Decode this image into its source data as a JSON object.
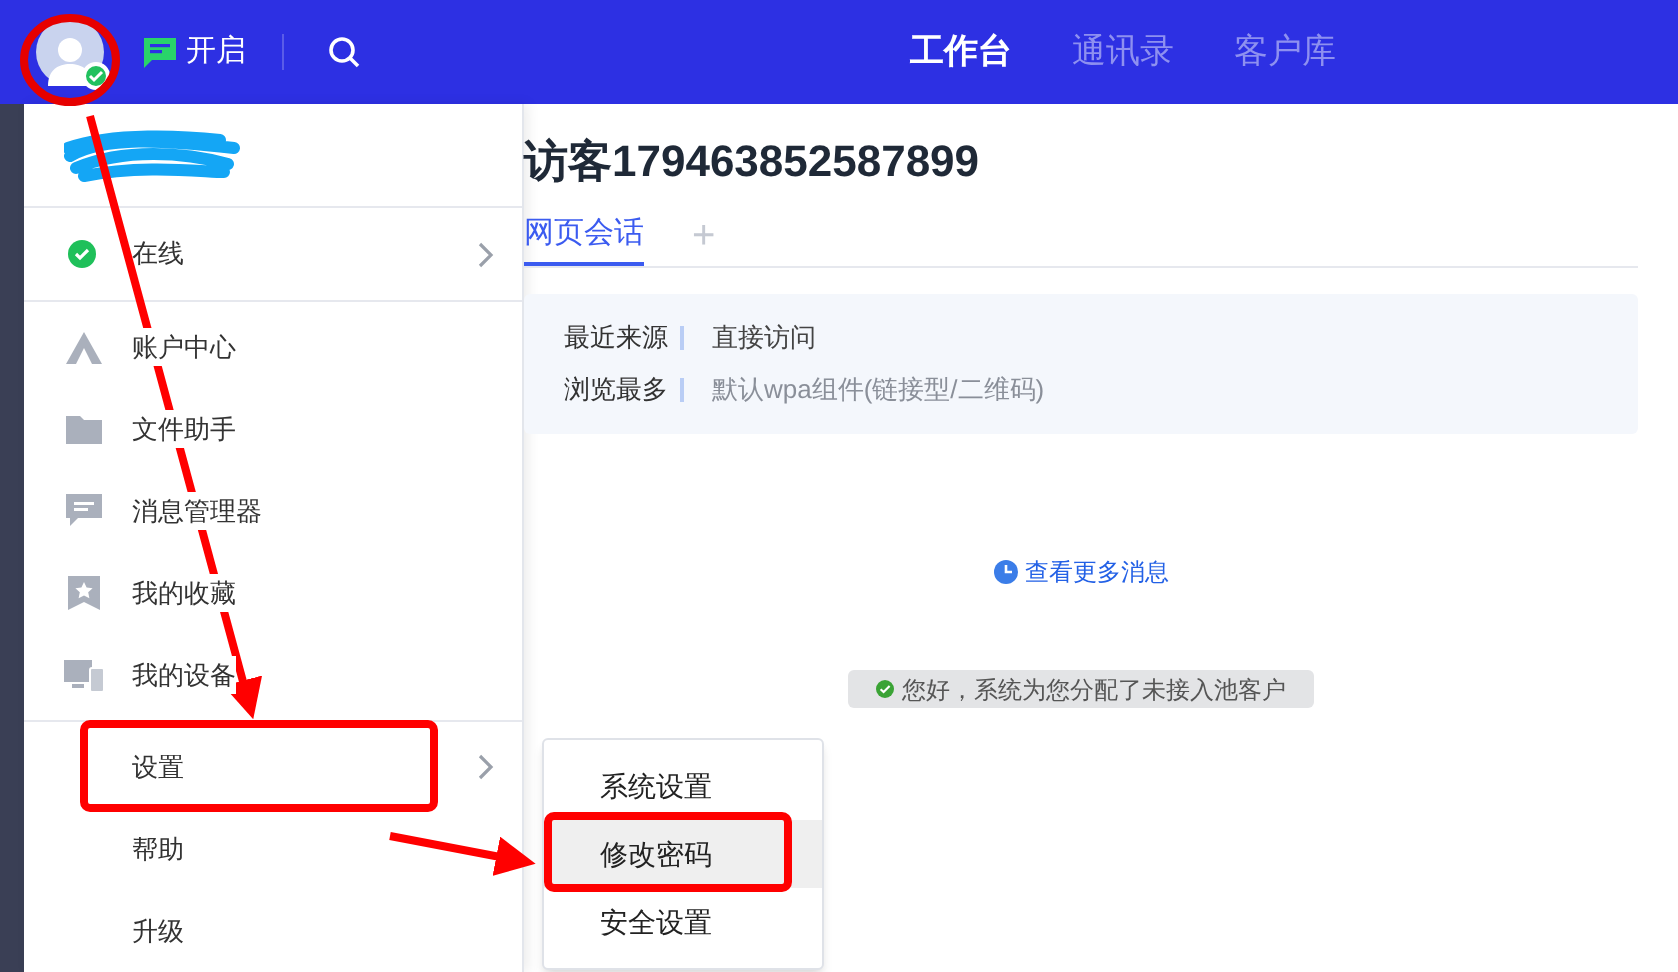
{
  "topbar": {
    "avatar_online": true,
    "toggle_label": "开启",
    "nav": [
      {
        "label": "工作台",
        "selected": true
      },
      {
        "label": "通讯录",
        "selected": false
      },
      {
        "label": "客户库",
        "selected": false
      }
    ]
  },
  "menu": {
    "status": {
      "label": "在线",
      "online": true
    },
    "tools": [
      {
        "label": "账户中心"
      },
      {
        "label": "文件助手"
      },
      {
        "label": "消息管理器"
      },
      {
        "label": "我的收藏"
      },
      {
        "label": "我的设备"
      }
    ],
    "bottom": [
      {
        "label": "设置",
        "has_submenu": true
      },
      {
        "label": "帮助",
        "has_submenu": false
      },
      {
        "label": "升级",
        "has_submenu": false
      }
    ]
  },
  "submenu": [
    {
      "label": "系统设置",
      "selected": false
    },
    {
      "label": "修改密码",
      "selected": true
    },
    {
      "label": "安全设置",
      "selected": false
    }
  ],
  "chat": {
    "title": "访客179463852587899",
    "tabs": [
      {
        "label": "网页会话",
        "selected": true
      }
    ],
    "add_tab": "+",
    "info": [
      {
        "label": "最近来源",
        "value": "直接访问",
        "muted": false
      },
      {
        "label": "浏览最多",
        "value": "默认wpa组件(链接型/二维码)",
        "muted": true
      }
    ],
    "more_link": "查看更多消息",
    "notice": "您好，系统为您分配了未接入池客户"
  }
}
